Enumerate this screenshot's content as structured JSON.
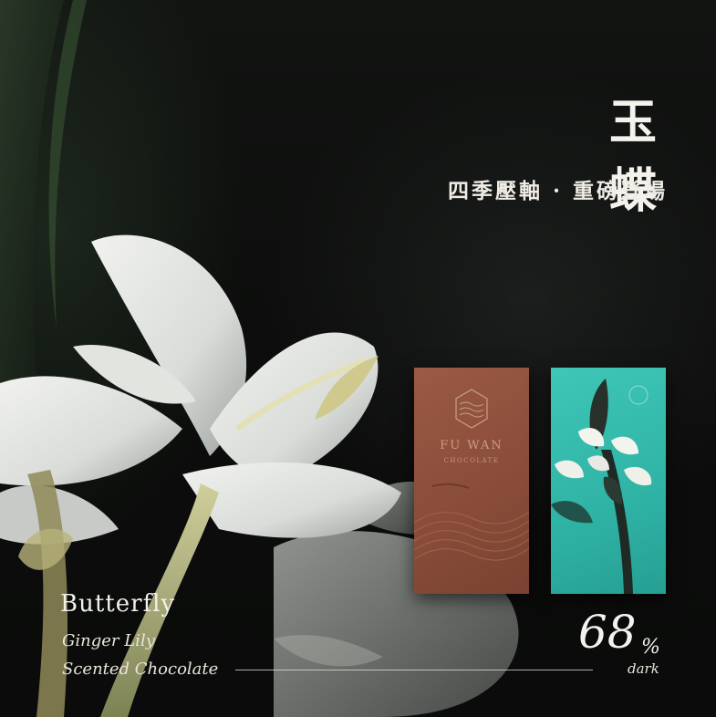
{
  "headline": {
    "title": "玉  蝶",
    "subtitle": "四季壓軸 · 重磅登場"
  },
  "product": {
    "name": "Butterfly",
    "description_line1": "Ginger Lily",
    "description_line2": "Scented Chocolate",
    "cocoa_percent": "68",
    "percent_sign": "%",
    "percent_label": "dark"
  },
  "package": {
    "brand": "FU WAN",
    "brand_sub": "CHOCOLATE"
  },
  "colors": {
    "background": "#0b0c0b",
    "text": "#f4f2ec",
    "brown_wrapper": "#8a4d3a",
    "teal_wrapper": "#2fb3a5",
    "gold_foil": "#c9a07e"
  },
  "icons": {
    "brand_logo": "hexagon-wave-logo-icon",
    "lily_illustration": "ginger-lily-illustration-icon"
  }
}
